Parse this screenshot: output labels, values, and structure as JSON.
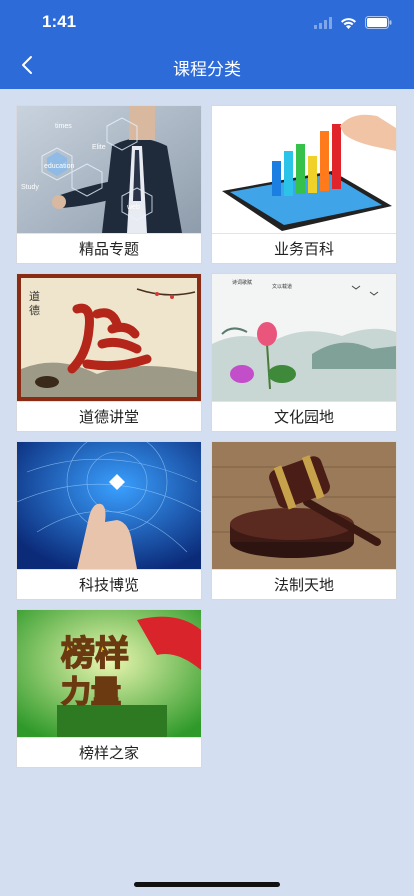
{
  "status_bar": {
    "time": "1:41"
  },
  "nav": {
    "title": "课程分类"
  },
  "categories": [
    {
      "label": "精品专题",
      "image": "business-man-tech-icon"
    },
    {
      "label": "业务百科",
      "image": "tablet-bar-chart-icon"
    },
    {
      "label": "道德讲堂",
      "image": "calligraphy-de-icon"
    },
    {
      "label": "文化园地",
      "image": "chinese-lotus-painting-icon"
    },
    {
      "label": "科技博览",
      "image": "finger-digital-network-icon"
    },
    {
      "label": "法制天地",
      "image": "judge-gavel-icon"
    },
    {
      "label": "榜样之家",
      "image": "role-model-banner-icon"
    }
  ],
  "colors": {
    "header": "#2c6bd8",
    "background": "#d3dff0"
  }
}
